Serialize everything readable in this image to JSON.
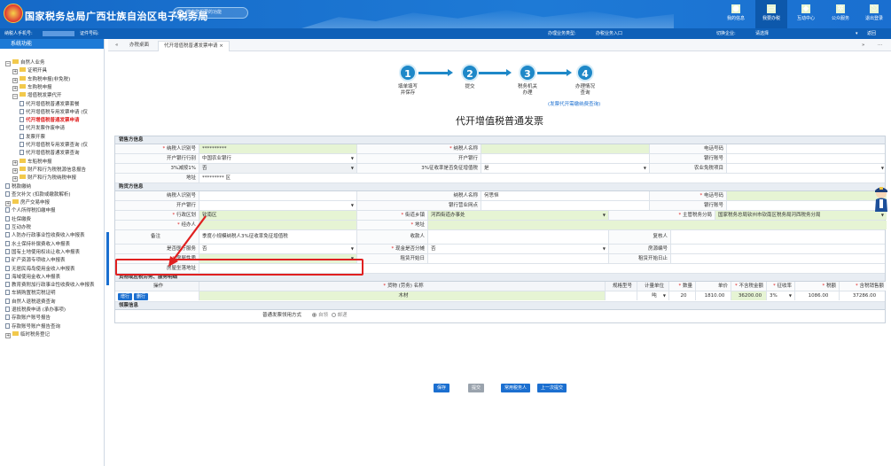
{
  "header": {
    "title": "国家税务总局广西壮族自治区电子税务局",
    "search_placeholder": "搜索您想要的功能",
    "nav": [
      {
        "icon": "user-icon",
        "label": "我的信息"
      },
      {
        "icon": "monitor-icon",
        "label": "我要办税"
      },
      {
        "icon": "chat-icon",
        "label": "互动中心"
      },
      {
        "icon": "gear-icon",
        "label": "公众服务"
      },
      {
        "icon": "exit-icon",
        "label": "退出登录"
      }
    ]
  },
  "subbar": {
    "phone_label": "纳税人手机号:",
    "cert_label": "证件号码:",
    "biz_type_label": "办理业务类型:",
    "biz_type": "办税业务入口",
    "switch_label": "切换企业:",
    "switch_value": "请选择",
    "back": "返回"
  },
  "sidebar": {
    "title": "系统功能",
    "items": [
      "自然人业务",
      "证明开具",
      "车购税申报(非免税)",
      "车购税申报",
      "增值税发票代开",
      "代开增值税普通发票套餐",
      "代开增值税专用发票申请 (仅",
      "代开增值税普通发票申请",
      "代开发票作废申请",
      "发票开票",
      "代开增值税专用发票查询 (仅",
      "代开增值税普通发票查询",
      "车船税申报",
      "财产和行为税税源信息报告",
      "财产和行为税纳税申报",
      "税款缴纳",
      "查欠补欠 (扣款或缴款解析)",
      "房产交易申报",
      "个人所得税扣缴申报",
      "社保缴费",
      "互动办税",
      "人防办行政事业性收费收入申报表",
      "水土保持补偿费收入申报表",
      "国有土地使用权出让收入申报表",
      "矿产资源专项收入申报表",
      "无居民海岛使用金收入申报表",
      "海域使用金收入申报表",
      "教育费附加行政事业性收费收入申报表",
      "车辆购置税完税证明",
      "自然人退税退费查询",
      "退抵税费申请 (承办事项)",
      "存款账户账号报告",
      "存款账号账户报告查询",
      "临时税务登记"
    ]
  },
  "tabs": {
    "home": "办税桌面",
    "active": "代开增值税普通发票申请"
  },
  "steps": [
    {
      "num": "1",
      "label": "填单填写\n并保存"
    },
    {
      "num": "2",
      "label": "提交"
    },
    {
      "num": "3",
      "label": "税务机关\n办理"
    },
    {
      "num": "4",
      "label": "办理情况\n查询"
    }
  ],
  "step_link": "(发票代开需缴纳费查询)",
  "form_title": "代开增值税普通发票",
  "seller": {
    "section": "销售方信息",
    "taxpayer_id_label": "纳税人识别号",
    "taxpayer_id": "**********",
    "name_label": "纳税人名称",
    "name": "",
    "phone_label": "电话号码",
    "phone": "",
    "bank_label": "开户银行行别",
    "bank": "中国农业银行",
    "branch_label": "开户银行",
    "branch": "",
    "account_label": "银行账号",
    "account": "",
    "rate_label": "3%减按1%",
    "rate": "否",
    "exempt_label": "3%征收率是否免征增值税",
    "exempt": "是",
    "special_label": "农业免税项目",
    "special": "",
    "address_label": "地址",
    "address": "********* 区"
  },
  "buyer": {
    "section": "购货方信息",
    "taxpayer_id_label": "纳税人识别号",
    "name_label": "纳税人名称",
    "name": "何思恒",
    "phone_label": "电话号码",
    "bank_label": "开户银行",
    "branch_label": "银行营业网点",
    "account_label": "银行账号",
    "district_label": "行政区划",
    "district": "钦南区",
    "street_label": "街道乡镇",
    "street": "河西街道办事处",
    "tax_office_label": "主管税务分局",
    "tax_office": "国家税务总局钦州市钦南区税务局河西税务分局",
    "agent_label": "经办人",
    "address_label": "地址",
    "note_label": "备注",
    "note": "季度小规模纳税人3%征收率免征增值税",
    "payee_label": "收款人",
    "reviewer_label": "复核人",
    "medical_label": "是否医疗服务",
    "medical": "否",
    "split_label": "现金是否分摊",
    "split": "否",
    "house_label": "房源编号",
    "nature_label": "房屋性质",
    "house_start_label": "租赁开始日",
    "house_end_label": "租赁开始日止",
    "house_addr_label": "房屋坐落地址"
  },
  "items": {
    "section": "货物或应税劳务、服务明细",
    "op_label": "操作",
    "add": "增行",
    "del": "删行",
    "name_label": "货物 (劳务) 名称",
    "spec_label": "规格型号",
    "unit_label": "计量单位",
    "qty_label": "数量",
    "price_label": "单价",
    "amount_label": "不含税金额",
    "rate_label": "征收率",
    "tax_label": "税额",
    "total_label": "含税销售额",
    "row": {
      "name": "木材",
      "unit": "吨",
      "qty": "20",
      "price": "1810.00",
      "amount": "36200.00",
      "rate": "3%",
      "tax": "1086.00",
      "total": "37286.00"
    }
  },
  "delivery": {
    "section": "领票信息",
    "label": "普通发票领用方式",
    "opt1": "自领",
    "opt2": "邮递"
  },
  "buttons": {
    "save": "保存",
    "submit": "提交",
    "common": "常用税务人",
    "prev": "上一次提交"
  }
}
